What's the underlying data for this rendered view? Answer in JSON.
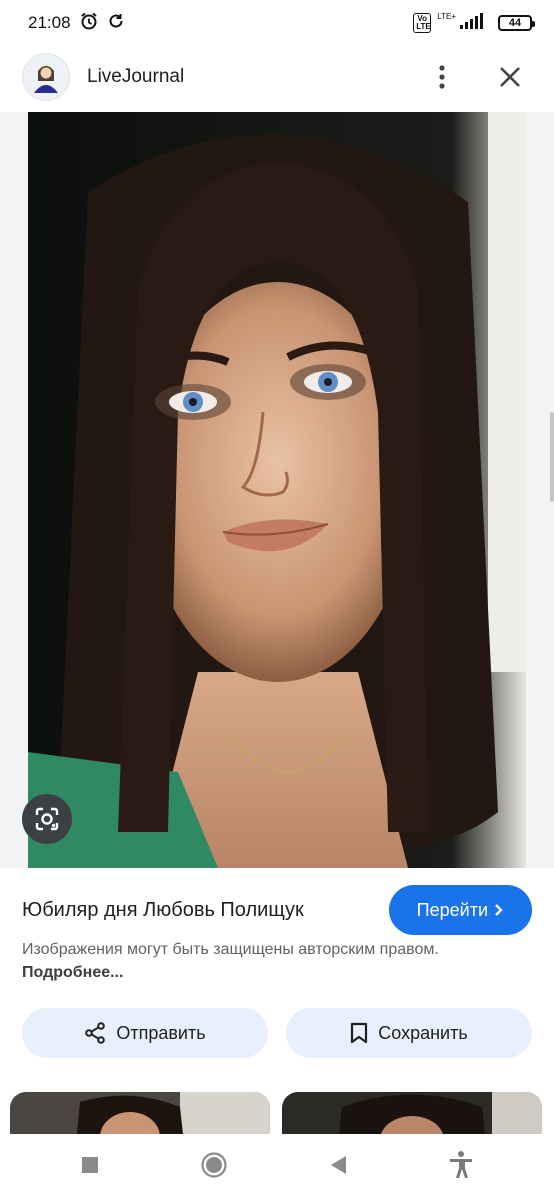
{
  "status_bar": {
    "time": "21:08",
    "network_badge": "Vo LTE",
    "network_label": "LTE+",
    "battery": "44"
  },
  "header": {
    "site_name": "LiveJournal"
  },
  "image": {
    "description_icon": "lens-icon"
  },
  "result": {
    "title": "Юбиляр дня Любовь Полищук",
    "visit_button": "Перейти",
    "copyright_text": "Изображения могут быть защищены авторским правом.",
    "more_link": "Подробнее..."
  },
  "actions": {
    "share_label": "Отправить",
    "save_label": "Сохранить"
  },
  "colors": {
    "accent": "#1a73e8",
    "action_bg": "#e8f0fe"
  }
}
